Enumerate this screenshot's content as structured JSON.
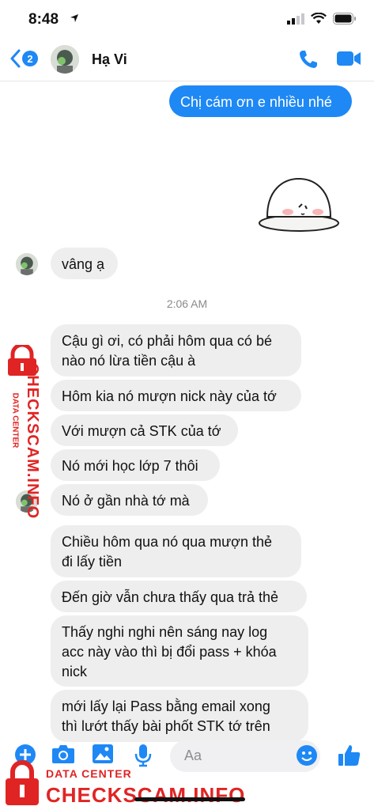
{
  "status_bar": {
    "time": "8:48"
  },
  "header": {
    "back_badge": "2",
    "contact_name": "Hạ Vi"
  },
  "messages": {
    "out_1": "Chị cám ơn e nhiều nhé",
    "in_1": "vâng ạ",
    "timestamp": "2:06 AM",
    "in_2_l1": "Cậu gì ơi, có phải hôm qua có bé",
    "in_2_l2": "nào nó lừa tiền cậu à",
    "in_3": "Hôm kia nó mượn nick này của tớ",
    "in_4": "Với mượn cả STK của tớ",
    "in_5": "Nó mới học lớp 7 thôi",
    "in_6": "Nó ở gần nhà tớ mà",
    "in_7_l1": "Chiều hôm qua nó qua mượn thẻ",
    "in_7_l2": "đi lấy tiền",
    "in_8": "Đến giờ vẫn chưa thấy qua trả thẻ",
    "in_9_l1": "Thấy nghi nghi nên sáng nay log",
    "in_9_l2": "acc này vào thì bị đổi pass + khóa",
    "in_9_l3": "nick",
    "in_10_l1": "mới lấy lại Pass bằng email xong",
    "in_10_l2": "thì lướt thấy bài phốt STK tớ trên"
  },
  "composer": {
    "placeholder": "Aa"
  },
  "watermark": {
    "title": "CHECKSCAM.INFO",
    "subtitle": "DATA CENTER"
  },
  "colors": {
    "accent": "#1e88f5",
    "incoming_bubble": "#eeeeef",
    "watermark": "#e02424"
  }
}
